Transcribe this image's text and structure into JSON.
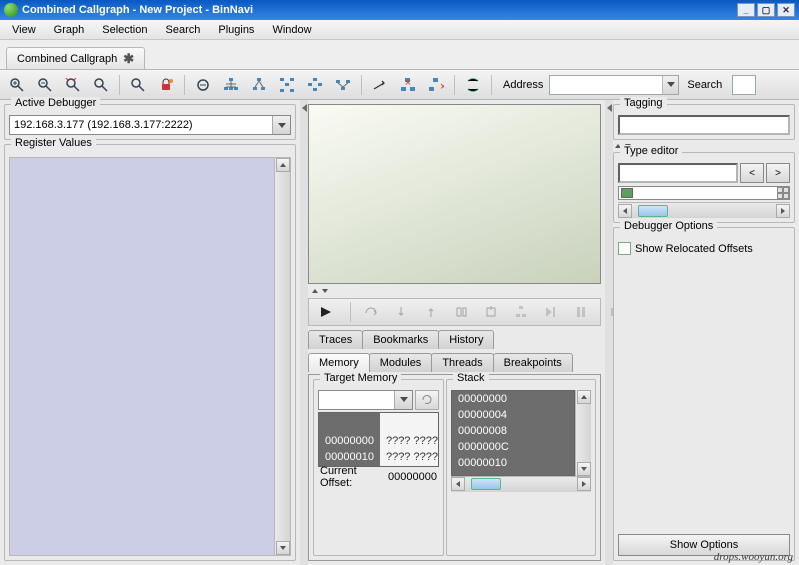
{
  "title": "Combined Callgraph - New Project - BinNavi",
  "menubar": [
    "View",
    "Graph",
    "Selection",
    "Search",
    "Plugins",
    "Window"
  ],
  "doc_tab": {
    "label": "Combined Callgraph"
  },
  "toolbar": {
    "address_label": "Address",
    "search_label": "Search"
  },
  "left": {
    "active_debugger_label": "Active Debugger",
    "debugger_value": "192.168.3.177 (192.168.3.177:2222)",
    "register_values_label": "Register Values"
  },
  "center": {
    "tabs_row1": [
      "Traces",
      "Bookmarks",
      "History"
    ],
    "tabs_row2": [
      "Memory",
      "Modules",
      "Threads",
      "Breakpoints"
    ],
    "target_memory_label": "Target Memory",
    "stack_label": "Stack",
    "mem_rows": [
      {
        "addr": "00000000",
        "hex": "???? ????"
      },
      {
        "addr": "00000010",
        "hex": "???? ????"
      }
    ],
    "stack_rows": [
      "00000000",
      "00000004",
      "00000008",
      "0000000C",
      "00000010"
    ],
    "current_offset_label": "Current Offset:",
    "current_offset_value": "00000000"
  },
  "right": {
    "tagging_label": "Tagging",
    "type_editor_label": "Type editor",
    "lt_label": "<",
    "gt_label": ">",
    "debugger_options_label": "Debugger Options",
    "show_relocated_label": "Show Relocated Offsets",
    "show_options_label": "Show Options"
  },
  "watermark": "drops.wooyun.org"
}
